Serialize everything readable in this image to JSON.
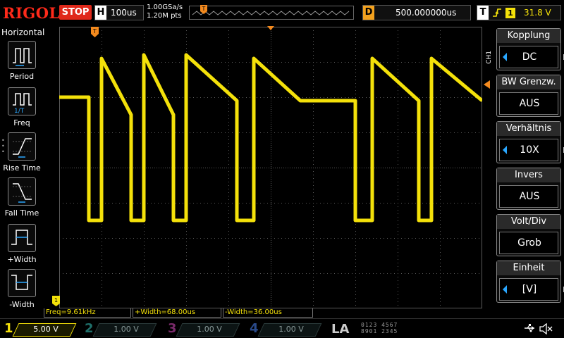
{
  "brand": "RIGOL",
  "status": "STOP",
  "horizontal": {
    "letter": "H",
    "scale": "100us"
  },
  "acquisition": {
    "sample_rate": "1.00GSa/s",
    "memory_depth": "1.20M pts"
  },
  "delay": {
    "letter": "D",
    "value": "500.000000us"
  },
  "trigger": {
    "letter": "T",
    "edge_icon": "rising-edge-icon",
    "source": "1",
    "level": "31.8 V"
  },
  "left_panel": {
    "title": "Horizontal",
    "items": [
      {
        "label": "Period",
        "icon": "period-icon"
      },
      {
        "label": "Freq",
        "icon": "frequency-icon"
      },
      {
        "label": "Rise Time",
        "icon": "rise-time-icon"
      },
      {
        "label": "Fall Time",
        "icon": "fall-time-icon"
      },
      {
        "label": "+Width",
        "icon": "positive-width-icon"
      },
      {
        "label": "-Width",
        "icon": "negative-width-icon"
      }
    ]
  },
  "measurements": {
    "freq": "Freq=9.61kHz",
    "pos_width": "+Width=68.00us",
    "neg_width": "-Width=36.00us"
  },
  "channel_menu": {
    "label": "CH1",
    "items": [
      {
        "title": "Kopplung",
        "value": "DC"
      },
      {
        "title": "BW Grenzw.",
        "value": "AUS"
      },
      {
        "title": "Verhältnis",
        "value": "10X"
      },
      {
        "title": "Invers",
        "value": "AUS"
      },
      {
        "title": "Volt/Div",
        "value": "Grob"
      },
      {
        "title": "Einheit",
        "value": "[V]"
      }
    ]
  },
  "channels": [
    {
      "num": "1",
      "scale": "5.00 V",
      "color": "#f4e10a",
      "active": true
    },
    {
      "num": "2",
      "scale": "1.00 V",
      "color": "#1f6f6a",
      "active": false
    },
    {
      "num": "3",
      "scale": "1.00 V",
      "color": "#7a2a6a",
      "active": false
    },
    {
      "num": "4",
      "scale": "1.00 V",
      "color": "#2a4a8a",
      "active": false
    }
  ],
  "logic_analyzer": {
    "label": "LA",
    "row1": "0123 4567",
    "row2": "8901 2345"
  },
  "colors": {
    "trace": "#f4e10a",
    "trigger_marker": "#f48a1e",
    "grid": "#5a5a5a",
    "brand": "#ff2a1a",
    "accent": "#2aa7ff"
  },
  "chart_data": {
    "type": "line",
    "series": [
      {
        "name": "CH1",
        "points": [
          [
            0,
            2.0
          ],
          [
            0.7,
            2.0
          ],
          [
            0.7,
            -1.5
          ],
          [
            1.0,
            -1.5
          ],
          [
            1.0,
            3.1
          ],
          [
            1.7,
            1.5
          ],
          [
            1.7,
            -1.5
          ],
          [
            2.0,
            -1.5
          ],
          [
            2.0,
            3.2
          ],
          [
            2.7,
            1.5
          ],
          [
            2.7,
            -1.5
          ],
          [
            3.0,
            -1.5
          ],
          [
            3.0,
            3.2
          ],
          [
            4.2,
            1.9
          ],
          [
            4.2,
            -1.5
          ],
          [
            4.6,
            -1.5
          ],
          [
            4.6,
            3.1
          ],
          [
            5.7,
            1.9
          ],
          [
            7.0,
            1.9
          ],
          [
            7.0,
            -1.5
          ],
          [
            7.4,
            -1.5
          ],
          [
            7.4,
            3.1
          ],
          [
            8.5,
            1.9
          ],
          [
            8.5,
            -1.5
          ],
          [
            8.8,
            -1.5
          ],
          [
            8.8,
            3.1
          ],
          [
            10.0,
            1.9
          ]
        ]
      }
    ],
    "x_range": [
      0,
      10
    ],
    "y_range": [
      -4,
      4
    ],
    "grid": true,
    "xlabel": "",
    "ylabel": ""
  }
}
